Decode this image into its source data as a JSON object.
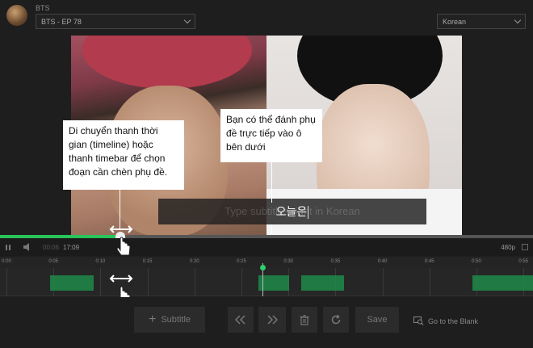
{
  "header": {
    "show_name": "BTS",
    "episode": "BTS - EP 78",
    "language": "Korean"
  },
  "video": {
    "subtitle_text": "오늘은",
    "subtitle_placeholder": "Type subtitles right in Korean"
  },
  "callouts": {
    "timeline_hint": "Di chuyển thanh thời gian (timeline) hoặc thanh timebar để chọn đoạn cần chèn phụ đề.",
    "type_hint": "Bạn có thể đánh phụ đề trực tiếp vào ô bên dưới"
  },
  "player": {
    "current_time": "00:06",
    "total_time": "17:09",
    "quality": "480p",
    "progress": 0.225
  },
  "timeline": {
    "ticks": [
      "0:00",
      "0:05",
      "0:10",
      "0:15",
      "0:20",
      "0:25",
      "0:30",
      "0:35",
      "0:40",
      "0:45",
      "0:50",
      "0:55"
    ]
  },
  "toolbar": {
    "subtitle_label": "Subtitle",
    "save_label": "Save",
    "go_blank_label": "Go to the Blank"
  },
  "colors": {
    "accent": "#29c459",
    "segment": "#1f8a4a"
  }
}
